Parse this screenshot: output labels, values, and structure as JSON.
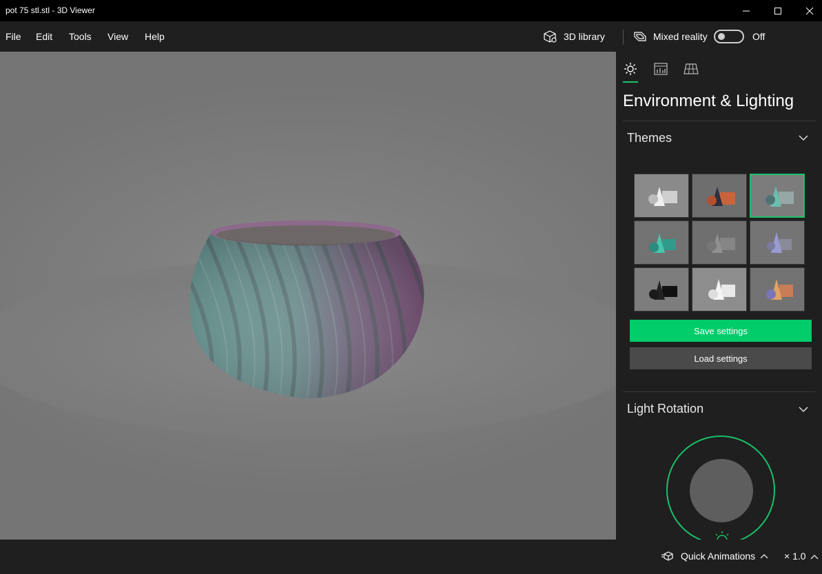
{
  "window": {
    "title": "pot 75 stl.stl - 3D Viewer",
    "minimize_icon": "minimize-icon",
    "maximize_icon": "maximize-icon",
    "close_icon": "close-icon"
  },
  "menu": {
    "items": [
      {
        "label": "File"
      },
      {
        "label": "Edit"
      },
      {
        "label": "Tools"
      },
      {
        "label": "View"
      },
      {
        "label": "Help"
      }
    ],
    "library_label": "3D library",
    "mixed_reality_label": "Mixed reality",
    "mixed_reality_state": "Off"
  },
  "panel": {
    "tabs": [
      {
        "icon": "sun-icon",
        "active": true
      },
      {
        "icon": "stats-icon",
        "active": false
      },
      {
        "icon": "grid-icon",
        "active": false
      }
    ],
    "title": "Environment & Lighting",
    "themes_label": "Themes",
    "themes": [
      {
        "name": "white",
        "selected": false
      },
      {
        "name": "orange-dark",
        "selected": false
      },
      {
        "name": "teal-gray",
        "selected": true
      },
      {
        "name": "teal",
        "selected": false
      },
      {
        "name": "gray",
        "selected": false
      },
      {
        "name": "purple",
        "selected": false
      },
      {
        "name": "black",
        "selected": false
      },
      {
        "name": "light",
        "selected": false
      },
      {
        "name": "orange-purple",
        "selected": false
      }
    ],
    "save_label": "Save settings",
    "load_label": "Load settings",
    "light_rotation_label": "Light Rotation"
  },
  "status": {
    "quick_animations_label": "Quick Animations",
    "speed_label": "× 1.0"
  },
  "colors": {
    "accent": "#00cc6a",
    "panel_bg": "#1f1f1f",
    "viewport_bg": "#7f7f7f"
  }
}
